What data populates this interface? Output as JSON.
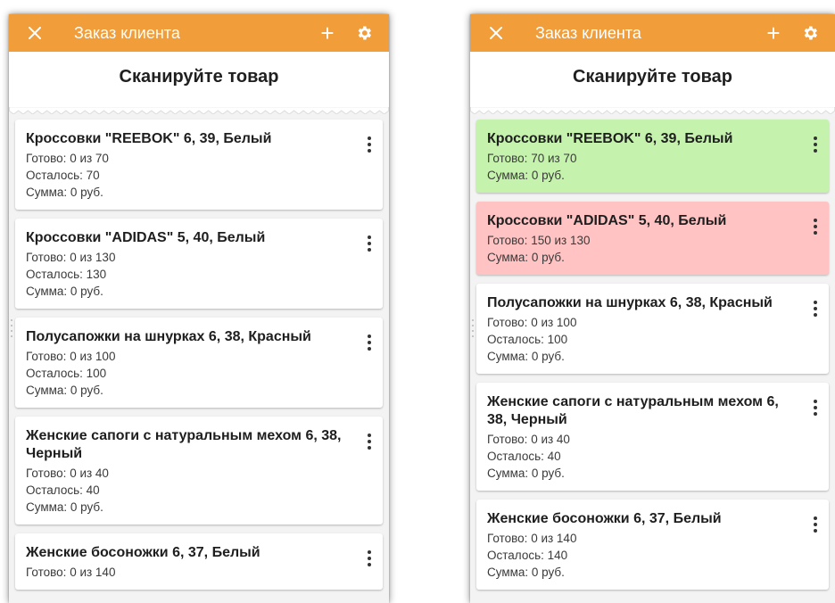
{
  "colors": {
    "appbar": "#f19d3a",
    "done_ok": "#c5f3ad",
    "done_over": "#ffc3c3"
  },
  "screens": [
    {
      "appbar": {
        "close_icon": "close-icon",
        "title": "Заказ клиента",
        "add_label": "+",
        "settings_icon": "gear-icon"
      },
      "scan_prompt": "Сканируйте товар",
      "items": [
        {
          "name": "Кроссовки \"REEBOK\" 6, 39, Белый",
          "ready": "Готово: 0 из 70",
          "left": "Осталось: 70",
          "sum": "Сумма: 0 руб.",
          "state": "normal"
        },
        {
          "name": "Кроссовки \"ADIDAS\" 5, 40, Белый",
          "ready": "Готово: 0 из 130",
          "left": "Осталось: 130",
          "sum": "Сумма: 0 руб.",
          "state": "normal"
        },
        {
          "name": "Полусапожки на шнурках 6, 38, Красный",
          "ready": "Готово: 0 из 100",
          "left": "Осталось: 100",
          "sum": "Сумма: 0 руб.",
          "state": "normal"
        },
        {
          "name": "Женские сапоги с натуральным мехом 6, 38, Черный",
          "ready": "Готово: 0 из 40",
          "left": "Осталось: 40",
          "sum": "Сумма: 0 руб.",
          "state": "normal"
        },
        {
          "name": "Женские босоножки 6, 37, Белый",
          "ready": "Готово: 0 из 140",
          "left": "",
          "sum": "",
          "state": "normal"
        }
      ]
    },
    {
      "appbar": {
        "close_icon": "close-icon",
        "title": "Заказ клиента",
        "add_label": "+",
        "settings_icon": "gear-icon"
      },
      "scan_prompt": "Сканируйте товар",
      "items": [
        {
          "name": "Кроссовки \"REEBOK\" 6, 39, Белый",
          "ready": "Готово: 70 из 70",
          "left": "",
          "sum": "Сумма: 0 руб.",
          "state": "green"
        },
        {
          "name": "Кроссовки \"ADIDAS\" 5, 40, Белый",
          "ready": "Готово: 150 из 130",
          "left": "",
          "sum": "Сумма: 0 руб.",
          "state": "red"
        },
        {
          "name": "Полусапожки на шнурках 6, 38, Красный",
          "ready": "Готово: 0 из 100",
          "left": "Осталось: 100",
          "sum": "Сумма: 0 руб.",
          "state": "normal"
        },
        {
          "name": "Женские сапоги с натуральным мехом 6, 38, Черный",
          "ready": "Готово: 0 из 40",
          "left": "Осталось: 40",
          "sum": "Сумма: 0 руб.",
          "state": "normal"
        },
        {
          "name": "Женские босоножки 6, 37, Белый",
          "ready": "Готово: 0 из 140",
          "left": "Осталось: 140",
          "sum": "Сумма: 0 руб.",
          "state": "normal"
        }
      ]
    }
  ]
}
